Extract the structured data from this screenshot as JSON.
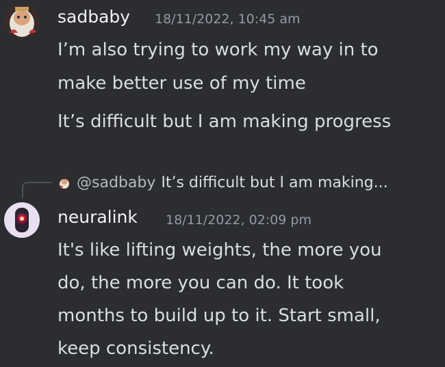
{
  "messages": [
    {
      "author": "sadbaby",
      "timestamp": "18/11/2022, 10:45 am",
      "lines": [
        "I’m also trying to work my way in to",
        "make better use of my time",
        "It’s difficult but I am making progress"
      ]
    },
    {
      "reply": {
        "mention": "@sadbaby",
        "preview": "It’s difficult but I am making..."
      },
      "author": "neuralink",
      "timestamp": "18/11/2022, 02:09 pm",
      "lines": [
        "It's like lifting weights, the more you",
        "do, the more you can do. It took",
        "months to build up to it. Start small,",
        "keep consistency."
      ]
    }
  ],
  "colors": {
    "background": "#2b2d31",
    "username": "#f2f3f5",
    "timestamp": "#949ba4",
    "text": "#dbdee1"
  },
  "icons": [
    "sadbaby-avatar",
    "neuralink-avatar",
    "reply-avatar"
  ]
}
